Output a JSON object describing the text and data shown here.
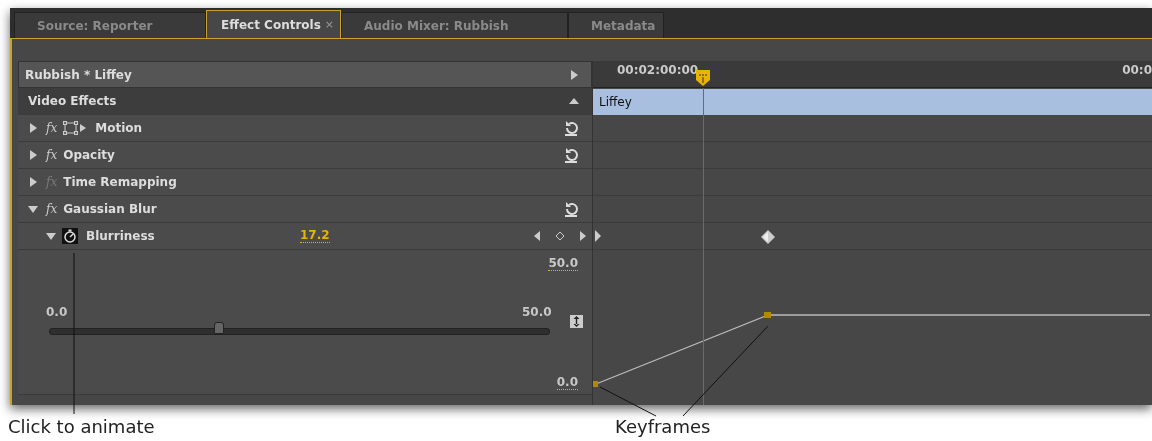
{
  "tabs": [
    {
      "label": "Source: Reporter",
      "selected": false
    },
    {
      "label": "Effect Controls",
      "selected": true,
      "close": "×"
    },
    {
      "label": "Audio Mixer: Rubbish",
      "selected": false
    },
    {
      "label": "Metadata",
      "selected": false
    }
  ],
  "sequence": {
    "title": "Rubbish * Liffey"
  },
  "section": {
    "title": "Video Effects",
    "expanded": true
  },
  "effects": [
    {
      "name": "Motion",
      "kind": "motion",
      "fx": "fx",
      "expanded": false,
      "enabled": true,
      "reset": true
    },
    {
      "name": "Opacity",
      "kind": "plain",
      "fx": "fx",
      "expanded": false,
      "enabled": true,
      "reset": true
    },
    {
      "name": "Time Remapping",
      "kind": "plain",
      "fx": "fx",
      "expanded": false,
      "enabled": false,
      "reset": false
    },
    {
      "name": "Gaussian Blur",
      "kind": "plain",
      "fx": "fx",
      "expanded": true,
      "enabled": true,
      "reset": true
    }
  ],
  "parameter": {
    "name": "Blurriness",
    "value": "17.2",
    "expanded": true,
    "animated": true,
    "graph_max": "50.0",
    "graph_min": "0.0",
    "slider_min": "0.0",
    "slider_max": "50.0",
    "level": 0.34
  },
  "timeline": {
    "timecodes": [
      "00:02:00:00",
      "00:0"
    ],
    "clip": "Liffey"
  },
  "callouts": [
    "Click to animate",
    "Keyframes"
  ]
}
